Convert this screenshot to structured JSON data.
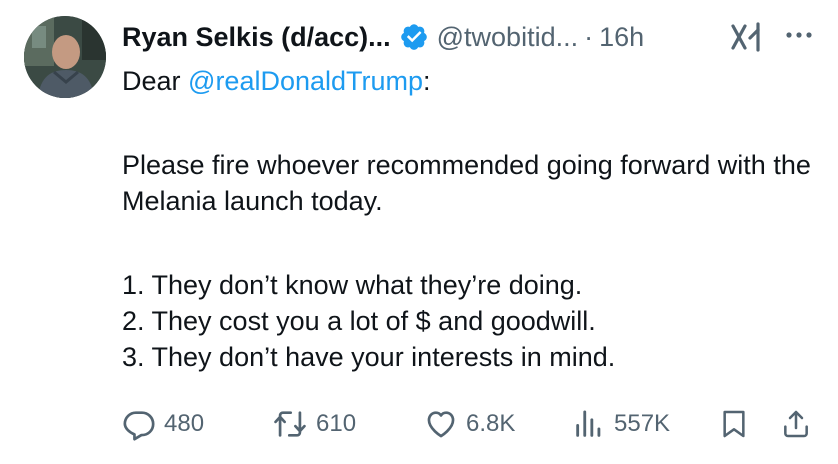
{
  "author": {
    "name": "Ryan Selkis (d/acc)...",
    "handle": "@twobitid...",
    "separator": "·",
    "time": "16h",
    "verified_color": "#1d9bf0"
  },
  "tweet": {
    "greeting_prefix": "Dear ",
    "mention": "@realDonaldTrump",
    "greeting_suffix": ":",
    "paragraph1": "Please fire whoever recommended going forward with the Melania launch today.",
    "list": [
      "1. They don’t know what they’re doing.",
      "2. They cost you a lot of $ and goodwill.",
      "3. They don’t have your interests in mind."
    ]
  },
  "actions": {
    "replies": "480",
    "reposts": "610",
    "likes": "6.8K",
    "views": "557K"
  },
  "icons": {
    "reply": "reply-icon",
    "repost": "repost-icon",
    "like": "heart-icon",
    "views": "views-icon",
    "bookmark": "bookmark-icon",
    "share": "share-icon",
    "grok": "grok-icon",
    "more": "more-icon"
  },
  "colors": {
    "link": "#1d9bf0",
    "muted": "#536471",
    "text": "#0f1419"
  }
}
